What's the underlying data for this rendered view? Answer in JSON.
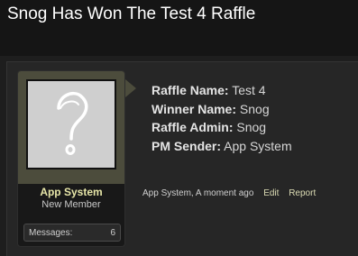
{
  "thread": {
    "title": "Snog Has Won The Test 4 Raffle"
  },
  "author": {
    "name": "App System",
    "title": "New Member",
    "messages_label": "Messages:",
    "messages_count": "6",
    "avatar_icon": "question-mark-icon"
  },
  "post": {
    "fields": [
      {
        "label": "Raffle Name:",
        "value": "Test 4"
      },
      {
        "label": "Winner Name:",
        "value": "Snog"
      },
      {
        "label": "Raffle Admin:",
        "value": "Snog"
      },
      {
        "label": "PM Sender:",
        "value": "App System"
      }
    ],
    "byline": "App System, A moment ago",
    "edit_label": "Edit",
    "report_label": "Report"
  },
  "colors": {
    "accent": "#e7e6a8",
    "avatar_frame": "#4c4c3c",
    "background": "#1e1e1e"
  }
}
